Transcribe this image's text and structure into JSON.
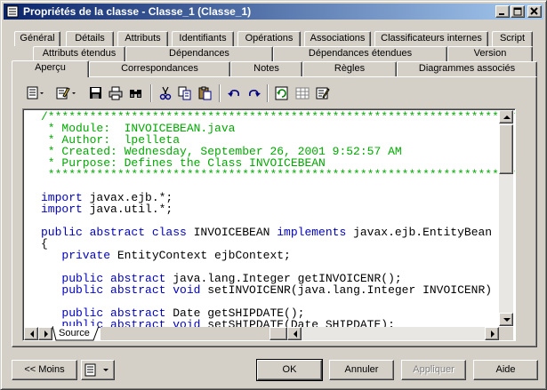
{
  "window": {
    "title": "Propriétés de la classe - Classe_1 (Classe_1)"
  },
  "tabs": {
    "row1": [
      "Général",
      "Détails",
      "Attributs",
      "Identifiants",
      "Opérations",
      "Associations",
      "Classificateurs internes",
      "Script"
    ],
    "row2": [
      "Attributs étendus",
      "Dépendances",
      "Dépendances étendues",
      "Version"
    ],
    "row3": [
      "Aperçu",
      "Correspondances",
      "Notes",
      "Règles",
      "Diagrammes associés"
    ],
    "active": "Aperçu"
  },
  "toolbar": {
    "icons": [
      "properties-menu-icon",
      "edit-menu-icon",
      "save-icon",
      "print-icon",
      "find-icon",
      "cut-icon",
      "copy-icon",
      "paste-icon",
      "undo-icon",
      "redo-icon",
      "refresh-icon",
      "grid-icon",
      "edit-properties-icon"
    ]
  },
  "editor": {
    "lines": [
      {
        "type": "cmt",
        "text": "/*********************************************************************"
      },
      {
        "type": "cmt",
        "text": " * Module:  INVOICEBEAN.java"
      },
      {
        "type": "cmt",
        "text": " * Author:  lpelleta"
      },
      {
        "type": "cmt",
        "text": " * Created: Wednesday, September 26, 2001 9:52:57 AM"
      },
      {
        "type": "cmt",
        "text": " * Purpose: Defines the Class INVOICEBEAN"
      },
      {
        "type": "cmt",
        "text": " *********************************************************************/"
      },
      {
        "type": "blank",
        "text": ""
      },
      {
        "type": "code",
        "parts": [
          [
            "kw",
            "import"
          ],
          [
            "t",
            " javax.ejb.*;"
          ]
        ]
      },
      {
        "type": "code",
        "parts": [
          [
            "kw",
            "import"
          ],
          [
            "t",
            " java.util.*;"
          ]
        ]
      },
      {
        "type": "blank",
        "text": ""
      },
      {
        "type": "code",
        "parts": [
          [
            "kw",
            "public abstract class"
          ],
          [
            "t",
            " INVOICEBEAN "
          ],
          [
            "kw",
            "implements"
          ],
          [
            "t",
            " javax.ejb.EntityBean"
          ]
        ]
      },
      {
        "type": "code",
        "parts": [
          [
            "t",
            "{"
          ]
        ]
      },
      {
        "type": "code",
        "parts": [
          [
            "t",
            "   "
          ],
          [
            "kw",
            "private"
          ],
          [
            "t",
            " EntityContext ejbContext;"
          ]
        ]
      },
      {
        "type": "blank",
        "text": ""
      },
      {
        "type": "code",
        "parts": [
          [
            "t",
            "   "
          ],
          [
            "kw",
            "public abstract"
          ],
          [
            "t",
            " java.lang.Integer getINVOICENR();"
          ]
        ]
      },
      {
        "type": "code",
        "parts": [
          [
            "t",
            "   "
          ],
          [
            "kw",
            "public abstract void"
          ],
          [
            "t",
            " setINVOICENR(java.lang.Integer INVOICENR)"
          ]
        ]
      },
      {
        "type": "blank",
        "text": ""
      },
      {
        "type": "code",
        "parts": [
          [
            "t",
            "   "
          ],
          [
            "kw",
            "public abstract"
          ],
          [
            "t",
            " Date getSHIPDATE();"
          ]
        ]
      },
      {
        "type": "code",
        "parts": [
          [
            "t",
            "   "
          ],
          [
            "kw",
            "public abstract void"
          ],
          [
            "t",
            " setSHIPDATE(Date SHIPDATE);"
          ]
        ]
      }
    ],
    "source_tab": "Source"
  },
  "buttons": {
    "less": "<< Moins",
    "ok": "OK",
    "cancel": "Annuler",
    "apply": "Appliquer",
    "help": "Aide"
  }
}
